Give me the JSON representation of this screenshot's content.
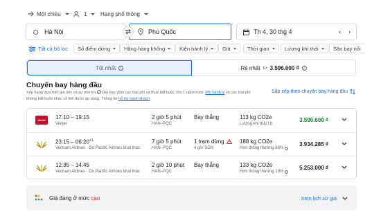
{
  "trip": {
    "type": "Một chiều",
    "passengers": "1",
    "class": "Hạng phổ thông"
  },
  "search": {
    "origin": "Hà Nội",
    "destination": "Phú Quốc",
    "date": "Th 4, 30 thg 4"
  },
  "filters": {
    "all": "Tất cả bộ lọc",
    "chips": [
      "Số điểm dừng",
      "Hãng hàng không",
      "Kiện hành lý",
      "Giá",
      "Thời gian",
      "Lượng khí thải",
      "Sân bay nối"
    ]
  },
  "sort": {
    "best_label": "Tốt nhất",
    "cheapest_label": "Rẻ nhất",
    "cheapest_prefix": "từ",
    "cheapest_price": "3.596.600 ₫"
  },
  "section": {
    "title": "Chuyến bay hàng đầu",
    "desc_1": "Xếp hạng dựa trên giá tiền và sự tiện lợi",
    "desc_2": "Giá bao gồm các loại phí và thuế bắt buộc cho 1 người lớn.",
    "desc_link_1": "Phí hành lý",
    "desc_3": "và các loại phí",
    "desc_4": "không bắt buộc khác có thể được áp dụng. Thông tin",
    "desc_link_2": "hỗ trợ hành khách",
    "sort_link": "Sắp xếp theo chuyến bay hàng đầu"
  },
  "flights": [
    {
      "time": "17:10 – 19:15",
      "day_offset": "",
      "airline": "Vietjet",
      "duration": "2 giờ 5 phút",
      "route": "HAN–PQC",
      "stops": "Bay thẳng",
      "stop_detail": "",
      "warning": false,
      "emissions": "113 kg CO2e",
      "emissions_note": "Lượng khí thải t.b",
      "price": "3.596.600 ₫",
      "price_color": "#188038",
      "logo": "vietjet-logo"
    },
    {
      "time": "23:15 – 06:20",
      "day_offset": "+1",
      "airline": "Vietnam Airlines · Do Pacific Airlines khai thác",
      "duration": "7 giờ 5 phút",
      "route": "HAN–PQC",
      "stops": "1 trạm dừng",
      "stop_detail": "4 giờ SGN",
      "warning": true,
      "emissions": "188 kg CO2e",
      "emissions_note": "Hơn thông thường 68%",
      "price": "3.934.285 ₫",
      "price_color": "#202124",
      "logo": "vietnam-airlines-logo"
    },
    {
      "time": "12:35 – 14:45",
      "day_offset": "",
      "airline": "Vietnam Airlines · Do Pacific Airlines khai thác",
      "duration": "2 giờ 10 phút",
      "route": "HAN–PQC",
      "stops": "Bay thẳng",
      "stop_detail": "",
      "warning": false,
      "emissions": "133 kg CO2e",
      "emissions_note": "Hơn thông thường 19%",
      "price": "5.253.000 ₫",
      "price_color": "#202124",
      "logo": "vietnam-airlines-logo"
    }
  ],
  "banner": {
    "text": "Giá đang ở mức",
    "level": "cao",
    "link": "Xem lịch sử giá"
  },
  "colors": {
    "accent": "#1a73e8",
    "cheap_green": "#188038",
    "price_high": "#d93025"
  }
}
